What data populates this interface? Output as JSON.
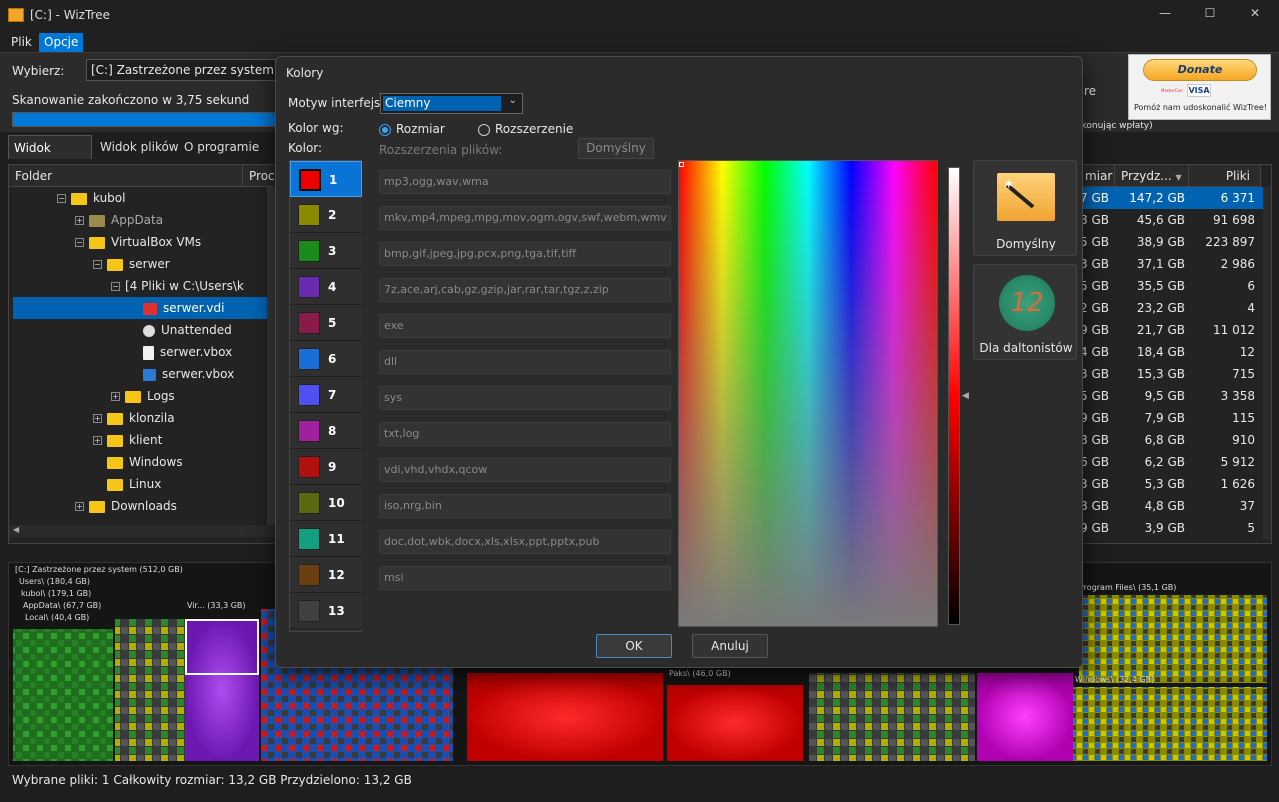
{
  "window": {
    "title": "[C:]  - WizTree",
    "minimize": "—",
    "maximize": "☐",
    "close": "✕"
  },
  "menu": {
    "file": "Plik",
    "options": "Opcje"
  },
  "top": {
    "select_label": "Wybierz:",
    "drive_value": "[C:] Zastrzeżone przez system",
    "scan_status": "Skanowanie zakończono w 3,75 sekund",
    "progress_fraction": 1.0,
    "partial_text_1": "re",
    "partial_text_2": "okonując wpłaty)"
  },
  "donate": {
    "button": "Donate",
    "mastercard": "MasterCard",
    "visa": "VISA",
    "caption": "Pomóż nam udoskonalić WizTree!"
  },
  "tabs": [
    "Widok drzewa",
    "Widok plików",
    "O programie"
  ],
  "tree": {
    "headers": {
      "folder": "Folder",
      "percent": "Proce",
      "size_partial": "miar",
      "allocated": "Przydz...",
      "files": "Pliki"
    },
    "rows": [
      {
        "name": "kubol",
        "indent": 3,
        "pm": "−",
        "folder": "yellow"
      },
      {
        "name": "AppData",
        "indent": 4,
        "pm": "+",
        "folder": "gray"
      },
      {
        "name": "VirtualBox VMs",
        "indent": 4,
        "pm": "−",
        "folder": "yellow"
      },
      {
        "name": "serwer",
        "indent": 5,
        "pm": "−",
        "folder": "yellow"
      },
      {
        "name": "[4 Pliki w C:\\Users\\k",
        "indent": 6,
        "pm": "−",
        "folder": "none"
      },
      {
        "name": "serwer.vdi",
        "indent": 7,
        "pm": "",
        "folder": "vdi",
        "selected": true
      },
      {
        "name": "Unattended",
        "indent": 7,
        "pm": "",
        "folder": "cog"
      },
      {
        "name": "serwer.vbox",
        "indent": 7,
        "pm": "",
        "folder": "file"
      },
      {
        "name": "serwer.vbox",
        "indent": 7,
        "pm": "",
        "folder": "vbox"
      },
      {
        "name": "Logs",
        "indent": 6,
        "pm": "+",
        "folder": "yellow"
      },
      {
        "name": "klonzila",
        "indent": 5,
        "pm": "+",
        "folder": "yellow"
      },
      {
        "name": "klient",
        "indent": 5,
        "pm": "+",
        "folder": "yellow"
      },
      {
        "name": "Windows",
        "indent": 5,
        "pm": "",
        "folder": "yellow"
      },
      {
        "name": "Linux",
        "indent": 5,
        "pm": "",
        "folder": "yellow"
      },
      {
        "name": "Downloads",
        "indent": 4,
        "pm": "+",
        "folder": "yellow"
      }
    ],
    "right_rows": [
      [
        "7 GB",
        "147,2 GB",
        "6 371"
      ],
      [
        "8 GB",
        "45,6 GB",
        "91 698"
      ],
      [
        "5 GB",
        "38,9 GB",
        "223 897"
      ],
      [
        "3 GB",
        "37,1 GB",
        "2 986"
      ],
      [
        "5 GB",
        "35,5 GB",
        "6"
      ],
      [
        "2 GB",
        "23,2 GB",
        "4"
      ],
      [
        "9 GB",
        "21,7 GB",
        "11 012"
      ],
      [
        "4 GB",
        "18,4 GB",
        "12"
      ],
      [
        "3 GB",
        "15,3 GB",
        "715"
      ],
      [
        "5 GB",
        "9,5 GB",
        "3 358"
      ],
      [
        "9 GB",
        "7,9 GB",
        "115"
      ],
      [
        "8 GB",
        "6,8 GB",
        "910"
      ],
      [
        "6 GB",
        "6,2 GB",
        "5 912"
      ],
      [
        "3 GB",
        "5,3 GB",
        "1 626"
      ],
      [
        "8 GB",
        "4,8 GB",
        "37"
      ],
      [
        "9 GB",
        "3,9 GB",
        "5"
      ]
    ]
  },
  "treemap_labels": {
    "root": "[C:] Zastrzeżone przez system  (512,0 GB)",
    "users": "Users\\ (180,4 GB)",
    "kubol": "kubol\\ (179,1 GB)",
    "appdata": "AppData\\ (67,7 GB)",
    "local": "Local\\ (40,4 GB)",
    "vir": "Vir... (33,3 GB)",
    "paks": "Paks\\ (46,0 GB)",
    "program_files": "Program Files\\ (35,1 GB)",
    "windows": "Windows\\ (32,4 GB)"
  },
  "status": "Wybrane pliki: 1  Całkowity rozmiar: 13,2 GB  Przydzielono: 13,2 GB",
  "dialog": {
    "title": "Kolory",
    "theme_label": "Motyw interfejsu",
    "theme_value": "Ciemny",
    "color_by_label": "Kolor wg:",
    "radio_size": "Rozmiar",
    "radio_ext": "Rozszerzenie",
    "color_label": "Kolor:",
    "ext_label": "Rozszerzenia plików:",
    "default_small": "Domyślny",
    "preset_default": "Domyślny",
    "preset_colorblind": "Dla daltonistów",
    "colorblind_number": "12",
    "ok": "OK",
    "cancel": "Anuluj",
    "colors": [
      {
        "num": "1",
        "hex": "#ee0000",
        "ext": "mp3,ogg,wav,wma"
      },
      {
        "num": "2",
        "hex": "#8a8a00",
        "ext": "mkv,mp4,mpeg,mpg,mov,ogm,ogv,swf,webm,wmv"
      },
      {
        "num": "3",
        "hex": "#1a8a1a",
        "ext": "bmp,gif,jpeg,jpg,pcx,png,tga,tif,tiff"
      },
      {
        "num": "4",
        "hex": "#6a2ab0",
        "ext": "7z,ace,arj,cab,gz,gzip,jar,rar,tar,tgz,z,zip"
      },
      {
        "num": "5",
        "hex": "#8a1a4a",
        "ext": "exe"
      },
      {
        "num": "6",
        "hex": "#1a6ed8",
        "ext": "dll"
      },
      {
        "num": "7",
        "hex": "#5050f0",
        "ext": "sys"
      },
      {
        "num": "8",
        "hex": "#a020a0",
        "ext": "txt,log"
      },
      {
        "num": "9",
        "hex": "#b01010",
        "ext": "vdi,vhd,vhdx,qcow"
      },
      {
        "num": "10",
        "hex": "#5a6a10",
        "ext": "iso,nrg,bin"
      },
      {
        "num": "11",
        "hex": "#12a080",
        "ext": "doc,dot,wbk,docx,xls,xlsx,ppt,pptx,pub"
      },
      {
        "num": "12",
        "hex": "#6a4010",
        "ext": "msi"
      },
      {
        "num": "13",
        "hex": "#404040",
        "ext": ""
      }
    ]
  }
}
